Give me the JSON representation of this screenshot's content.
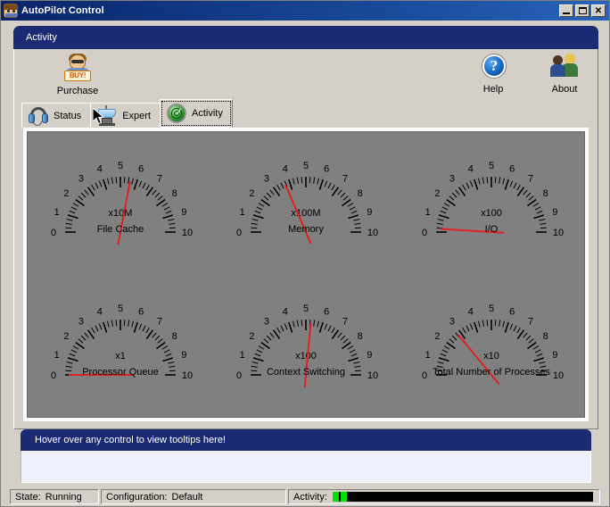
{
  "window": {
    "title": "AutoPilot Control",
    "icon": "app-face-icon",
    "buttons": {
      "minimize": "minimize",
      "maximize": "maximize",
      "close": "close"
    }
  },
  "header": {
    "title": "Activity"
  },
  "toolbar": {
    "items": [
      {
        "label": "Purchase",
        "icon": "purchase-icon",
        "badge": "BUY!"
      },
      {
        "label": "Help",
        "icon": "help-icon",
        "glyph": "?"
      },
      {
        "label": "About",
        "icon": "about-people-icon"
      }
    ]
  },
  "tabs": [
    {
      "label": "Status",
      "icon": "headphones-icon",
      "selected": false
    },
    {
      "label": "Expert",
      "icon": "anvil-icon",
      "selected": false
    },
    {
      "label": "Activity",
      "icon": "radar-icon",
      "selected": true
    }
  ],
  "gauges": [
    {
      "caption": "File Cache",
      "multiplier": "x10M",
      "value": 5.6,
      "min": 0,
      "max": 10
    },
    {
      "caption": "Memory",
      "multiplier": "x100M",
      "value": 3.7,
      "min": 0,
      "max": 10
    },
    {
      "caption": "I/O",
      "multiplier": "x100",
      "value": 0.2,
      "min": 0,
      "max": 10
    },
    {
      "caption": "Processor Queue",
      "multiplier": "x1",
      "value": 0.0,
      "min": 0,
      "max": 10
    },
    {
      "caption": "Context Switching",
      "multiplier": "x100",
      "value": 5.3,
      "min": 0,
      "max": 10
    },
    {
      "caption": "Total Number of Processes",
      "multiplier": "x10",
      "value": 2.8,
      "min": 0,
      "max": 10
    }
  ],
  "gauge_scale_labels": [
    "0",
    "1",
    "2",
    "3",
    "4",
    "5",
    "6",
    "7",
    "8",
    "9",
    "10"
  ],
  "tooltip": {
    "header": "Hover over any control to view tooltips here!",
    "body": ""
  },
  "statusbar": {
    "state_label": "State:",
    "state_value": "Running",
    "config_label": "Configuration:",
    "config_value": "Default",
    "activity_label": "Activity:",
    "activity_segments": 2
  },
  "colors": {
    "title_blue": "#0a246a",
    "header_navy": "#1a2a73",
    "panel_gray": "#808080",
    "needle_red": "#e02020",
    "activity_green": "#00e000",
    "face_beige": "#d4d0c8"
  }
}
